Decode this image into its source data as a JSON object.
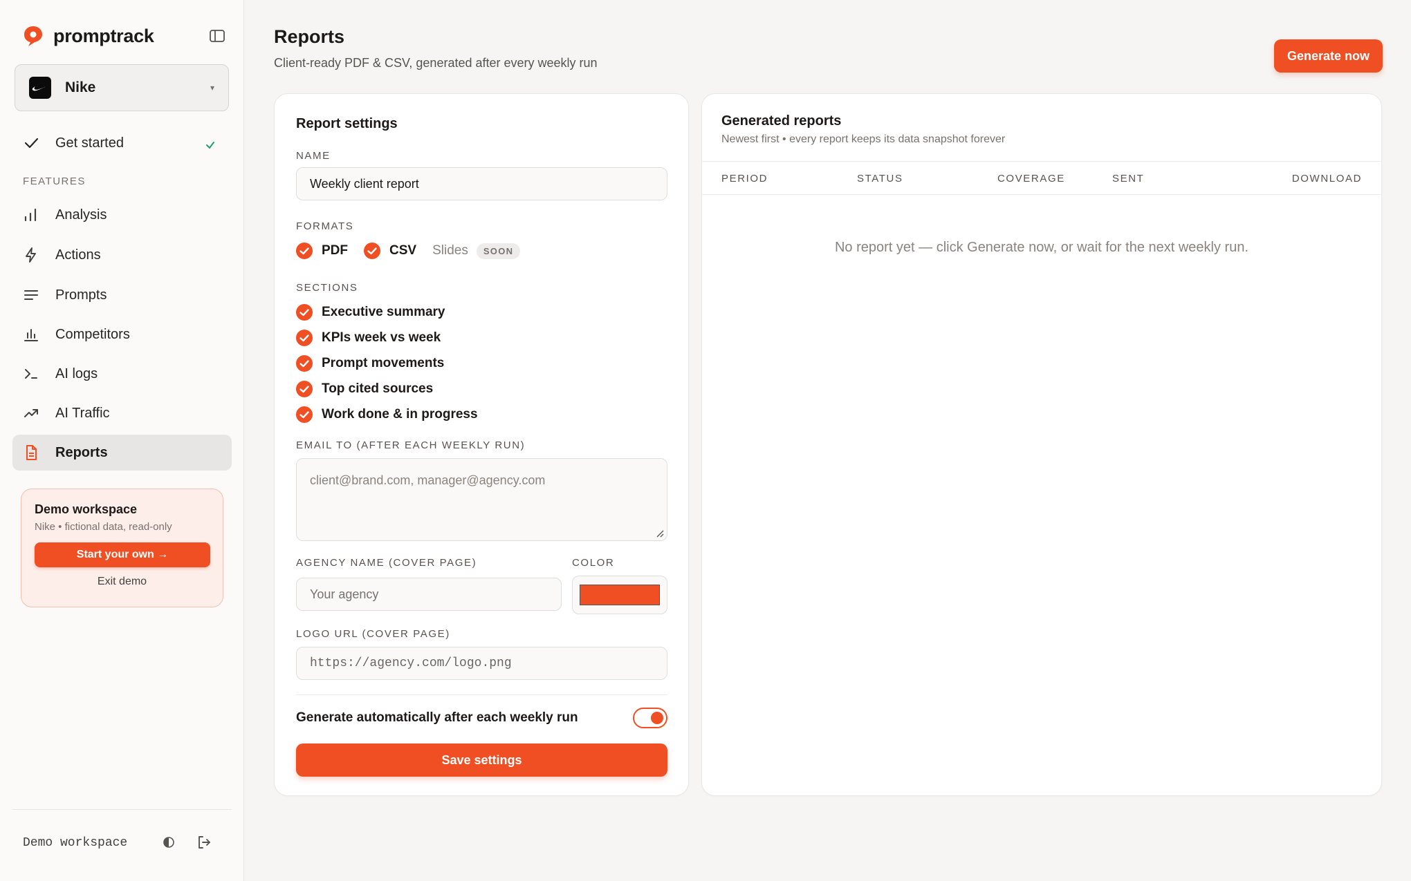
{
  "app": {
    "name": "promptrack",
    "brand_color": "#f04e23"
  },
  "workspace": {
    "name": "Nike"
  },
  "nav": {
    "get_started": "Get started",
    "section_label": "FEATURES",
    "items": [
      {
        "label": "Analysis",
        "icon": "bar-chart-icon"
      },
      {
        "label": "Actions",
        "icon": "bolt-icon"
      },
      {
        "label": "Prompts",
        "icon": "lines-icon"
      },
      {
        "label": "Competitors",
        "icon": "column-chart-icon"
      },
      {
        "label": "AI logs",
        "icon": "terminal-icon"
      },
      {
        "label": "AI Traffic",
        "icon": "trend-up-icon"
      },
      {
        "label": "Reports",
        "icon": "document-icon",
        "active": true
      }
    ]
  },
  "demo": {
    "title": "Demo workspace",
    "subtitle": "Nike • fictional data, read-only",
    "start_label": "Start your own →",
    "exit_label": "Exit demo"
  },
  "footer": {
    "label": "Demo workspace"
  },
  "page": {
    "title": "Reports",
    "subtitle": "Client-ready PDF & CSV, generated after every weekly run",
    "generate_label": "Generate now"
  },
  "settings": {
    "title": "Report settings",
    "name_label": "NAME",
    "name_value": "Weekly client report",
    "formats_label": "FORMATS",
    "formats": {
      "pdf": "PDF",
      "csv": "CSV",
      "slides": "Slides",
      "soon": "SOON"
    },
    "sections_label": "SECTIONS",
    "sections": [
      "Executive summary",
      "KPIs week vs week",
      "Prompt movements",
      "Top cited sources",
      "Work done & in progress"
    ],
    "email_label": "EMAIL TO (AFTER EACH WEEKLY RUN)",
    "email_placeholder": "client@brand.com, manager@agency.com",
    "agency_label": "AGENCY NAME (COVER PAGE)",
    "agency_placeholder": "Your agency",
    "color_label": "COLOR",
    "color_value": "#f04e23",
    "logo_label": "LOGO URL (COVER PAGE)",
    "logo_placeholder": "https://agency.com/logo.png",
    "auto_label": "Generate automatically after each weekly run",
    "auto_enabled": true,
    "save_label": "Save settings"
  },
  "reports": {
    "title": "Generated reports",
    "subtitle": "Newest first • every report keeps its data snapshot forever",
    "columns": [
      "PERIOD",
      "STATUS",
      "COVERAGE",
      "SENT",
      "DOWNLOAD"
    ],
    "empty_text": "No report yet — click Generate now, or wait for the next weekly run."
  }
}
